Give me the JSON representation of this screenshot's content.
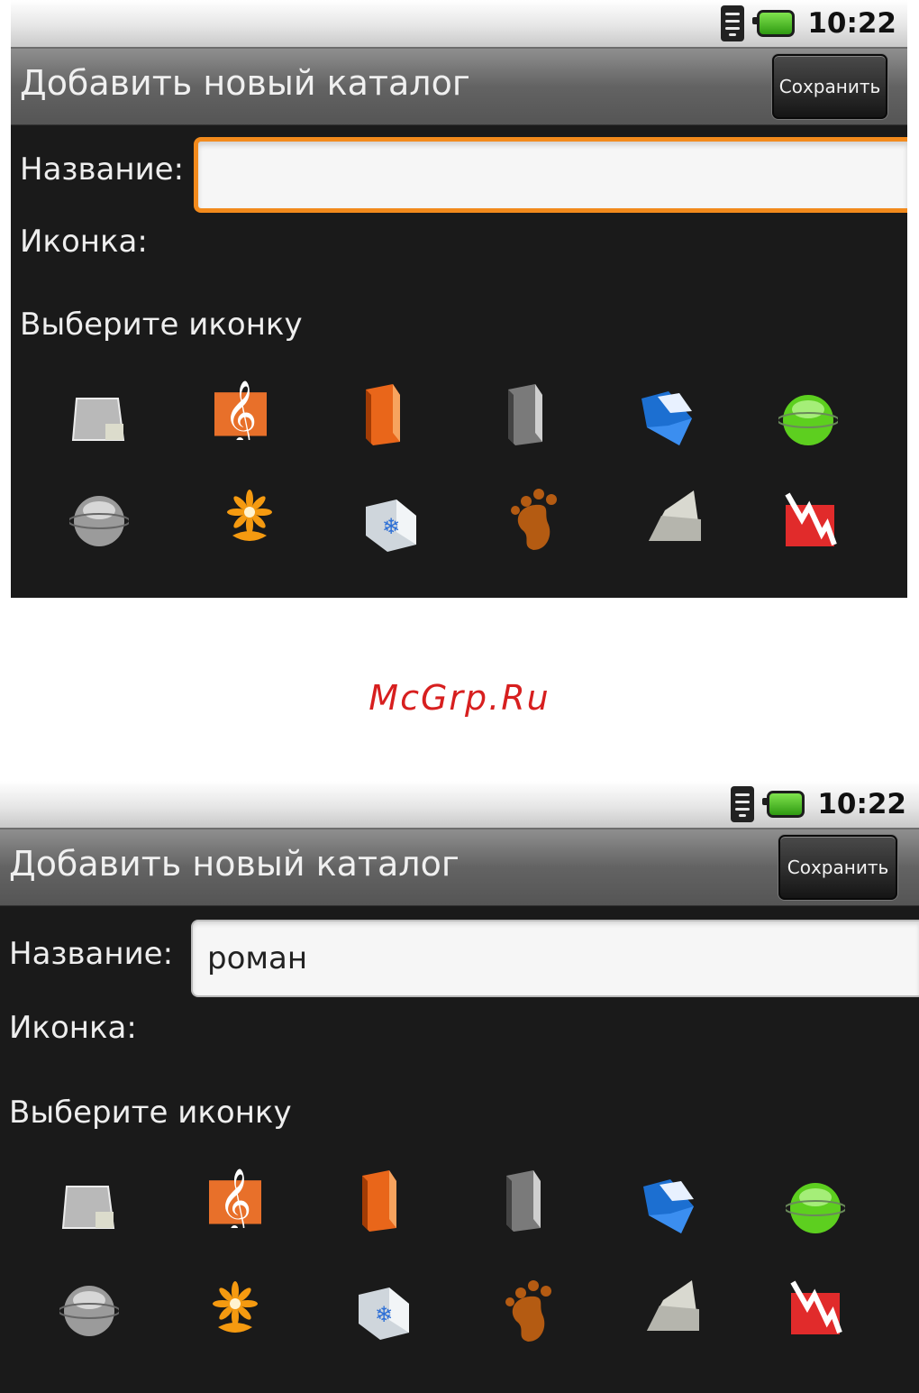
{
  "watermark": "McGrp.Ru",
  "screens": [
    {
      "status": {
        "time": "10:22"
      },
      "title": "Добавить новый каталог",
      "save_label": "Сохранить",
      "name_label": "Название:",
      "name_value": "",
      "icon_label": "Иконка:",
      "choose_label": "Выберите иконку",
      "name_field_focused": true
    },
    {
      "status": {
        "time": "10:22"
      },
      "title": "Добавить новый каталог",
      "save_label": "Сохранить",
      "name_label": "Название:",
      "name_value": "роман",
      "icon_label": "Иконка:",
      "choose_label": "Выберите иконку",
      "name_field_focused": false
    }
  ],
  "icon_choices": [
    "folder-grey-icon",
    "music-note-icon",
    "orange-book-icon",
    "grey-book-icon",
    "blue-folder-icon",
    "green-globe-icon",
    "grey-globe-icon",
    "flower-icon",
    "medical-kit-icon",
    "footprint-icon",
    "open-folder-icon",
    "red-chart-icon"
  ]
}
